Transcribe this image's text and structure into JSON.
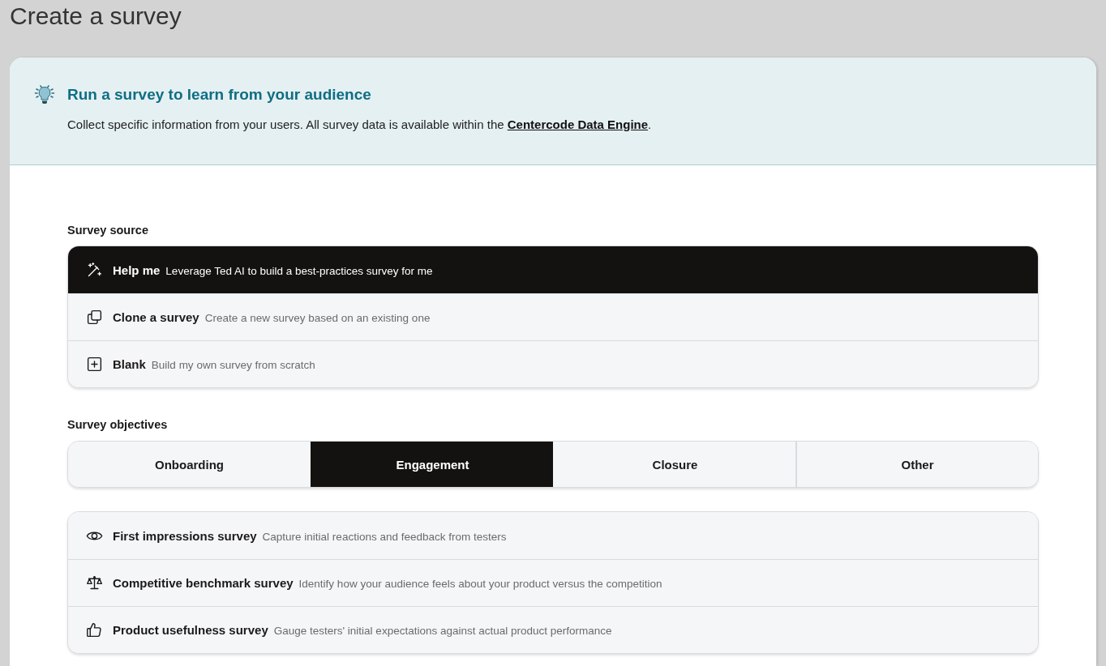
{
  "page_title": "Create a survey",
  "banner": {
    "heading": "Run a survey to learn from your audience",
    "text_before": "Collect specific information from your users. All survey data is available within the ",
    "link": "Centercode Data Engine",
    "text_after": "."
  },
  "survey_source": {
    "label": "Survey source",
    "options": [
      {
        "title": "Help me",
        "description": "Leverage Ted AI to build a best-practices survey for me",
        "selected": true
      },
      {
        "title": "Clone a survey",
        "description": "Create a new survey based on an existing one",
        "selected": false
      },
      {
        "title": "Blank",
        "description": "Build my own survey from scratch",
        "selected": false
      }
    ]
  },
  "survey_objectives": {
    "label": "Survey objectives",
    "tabs": [
      {
        "label": "Onboarding",
        "selected": false
      },
      {
        "label": "Engagement",
        "selected": true
      },
      {
        "label": "Closure",
        "selected": false
      },
      {
        "label": "Other",
        "selected": false
      }
    ]
  },
  "templates": [
    {
      "title": "First impressions survey",
      "description": "Capture initial reactions and feedback from testers"
    },
    {
      "title": "Competitive benchmark survey",
      "description": "Identify how your audience feels about your product versus the competition"
    },
    {
      "title": "Product usefulness survey",
      "description": "Gauge testers' initial expectations against actual product performance"
    }
  ]
}
